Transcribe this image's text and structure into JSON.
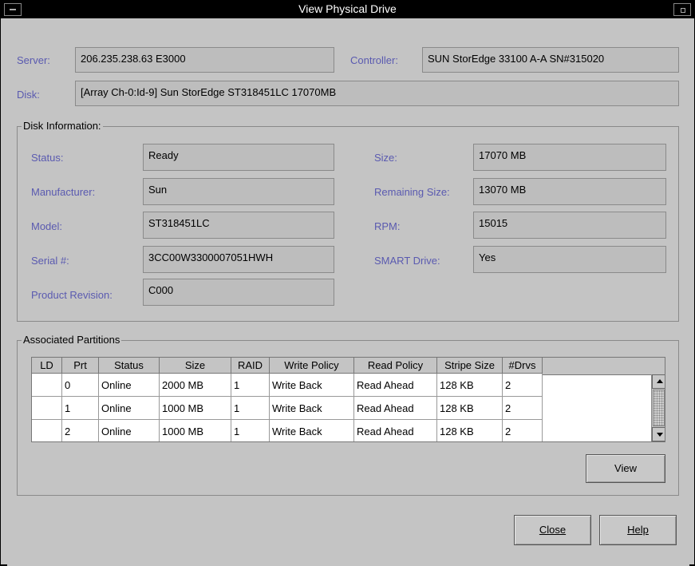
{
  "window": {
    "title": "View Physical Drive"
  },
  "header": {
    "server_label": "Server:",
    "server_value": "206.235.238.63 E3000",
    "controller_label": "Controller:",
    "controller_value": "SUN StorEdge 33100 A-A SN#315020",
    "disk_label": "Disk:",
    "disk_value": "[Array Ch-0:Id-9] Sun StorEdge ST318451LC 17070MB"
  },
  "disk_info": {
    "group_title": "Disk Information:",
    "status_label": "Status:",
    "status_value": "Ready",
    "manufacturer_label": "Manufacturer:",
    "manufacturer_value": "Sun",
    "model_label": "Model:",
    "model_value": "ST318451LC",
    "serial_label": "Serial #:",
    "serial_value": "3CC00W3300007051HWH",
    "revision_label": "Product Revision:",
    "revision_value": "C000",
    "size_label": "Size:",
    "size_value": "17070 MB",
    "remaining_label": "Remaining Size:",
    "remaining_value": "13070 MB",
    "rpm_label": "RPM:",
    "rpm_value": "15015",
    "smart_label": "SMART Drive:",
    "smart_value": "Yes"
  },
  "partitions": {
    "group_title": "Associated Partitions",
    "columns": [
      "LD",
      "Prt",
      "Status",
      "Size",
      "RAID",
      "Write Policy",
      "Read Policy",
      "Stripe Size",
      "#Drvs"
    ],
    "rows": [
      [
        "",
        "0",
        "Online",
        "2000 MB",
        "1",
        "Write Back",
        "Read Ahead",
        "128 KB",
        "2"
      ],
      [
        "",
        "1",
        "Online",
        "1000 MB",
        "1",
        "Write Back",
        "Read Ahead",
        "128 KB",
        "2"
      ],
      [
        "",
        "2",
        "Online",
        "1000 MB",
        "1",
        "Write Back",
        "Read Ahead",
        "128 KB",
        "2"
      ]
    ],
    "view_label": "View"
  },
  "footer": {
    "close_label": "Close",
    "help_label": "Help"
  },
  "colors": {
    "label": "#5a5ab0",
    "background": "#c4c4c4",
    "titlebar": "#000000"
  }
}
